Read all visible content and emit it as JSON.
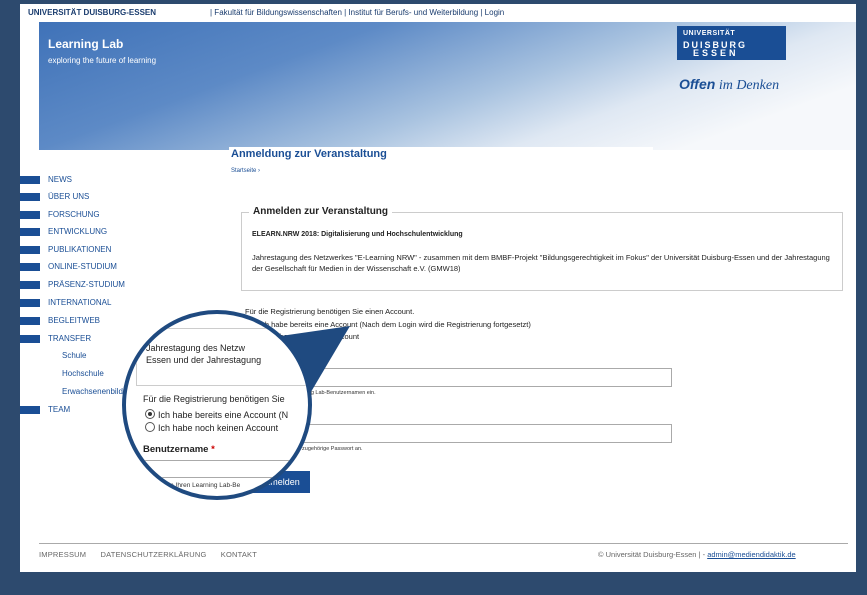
{
  "topbar": {
    "university": "UNIVERSITÄT DUISBURG-ESSEN",
    "links": "| Fakultät für Bildungswissenschaften | Institut für Berufs- und Weiterbildung | Login"
  },
  "banner": {
    "title": "Learning Lab",
    "subtitle": "exploring the future of learning",
    "logo_line1": "UNIVERSITÄT",
    "logo_line2": "DUISBURG",
    "logo_line3": "ESSEN",
    "slogan_bold": "Offen",
    "slogan_rest": " im Denken"
  },
  "page_title": "Anmeldung zur Veranstaltung",
  "breadcrumb": "Startseite ›",
  "nav": {
    "items": [
      "NEWS",
      "ÜBER UNS",
      "FORSCHUNG",
      "ENTWICKLUNG",
      "PUBLIKATIONEN",
      "ONLINE-STUDIUM",
      "PRÄSENZ-STUDIUM",
      "INTERNATIONAL",
      "BEGLEITWEB",
      "TRANSFER",
      "TEAM"
    ],
    "sub_items": [
      "Schule",
      "Hochschule",
      "Erwachsenenbildung"
    ]
  },
  "form": {
    "legend": "Anmelden zur Veranstaltung",
    "event_title": "ELEARN.NRW 2018: Digitalisierung und Hochschulentwicklung",
    "description": "Jahrestagung des Netzwerkes \"E-Learning NRW\" - zusammen mit dem BMBF-Projekt \"Bildungsgerechtigkeit im Fokus\" der Universität Duisburg-Essen und der Jahrestagung der Gesellschaft für Medien in der Wissenschaft e.V. (GMW18)",
    "account_question": "Für die Registrierung benötigen Sie einen Account.",
    "radio_has_account": "Ich habe bereits eine Account (Nach dem Login wird die Registrierung fortgesetzt)",
    "radio_no_account": "Ich habe noch keinen Account",
    "username_label": "Benutzername",
    "username_hint": "Geben Sie Ihren Learning Lab-Benutzernamen ein.",
    "password_hint": "Geben Sie hier das zugehörige Passwort an.",
    "required_mark": "*",
    "login_button": "Anmelden"
  },
  "magnifier": {
    "desc_line1": "Jahrestagung des Netzw",
    "desc_line2": "Essen und der Jahrestagung",
    "account_question": "Für die Registrierung benötigen Sie",
    "radio_has_account": "Ich habe bereits eine Account (N",
    "radio_no_account": "Ich habe noch keinen Account",
    "username_label": "Benutzername",
    "username_hint": "Geben Sie Ihren Learning Lab-Be",
    "visible_field_fragment": "rname",
    "visible_hint_fragment": "ren Learning Lab-Benutzernamen ein.",
    "visible_pw_fragment": "ier das zugehörige Passwort an.",
    "visible_button_fragment": "nmelden"
  },
  "footer": {
    "links": [
      "IMPRESSUM",
      "DATENSCHUTZERKLÄRUNG",
      "KONTAKT"
    ],
    "copyright": "© Universität Duisburg-Essen | -",
    "email": "admin@mediendidaktik.de"
  },
  "colors": {
    "primary": "#1a4e95",
    "outer_bg": "#2d4a6e",
    "required": "#cc0000"
  }
}
